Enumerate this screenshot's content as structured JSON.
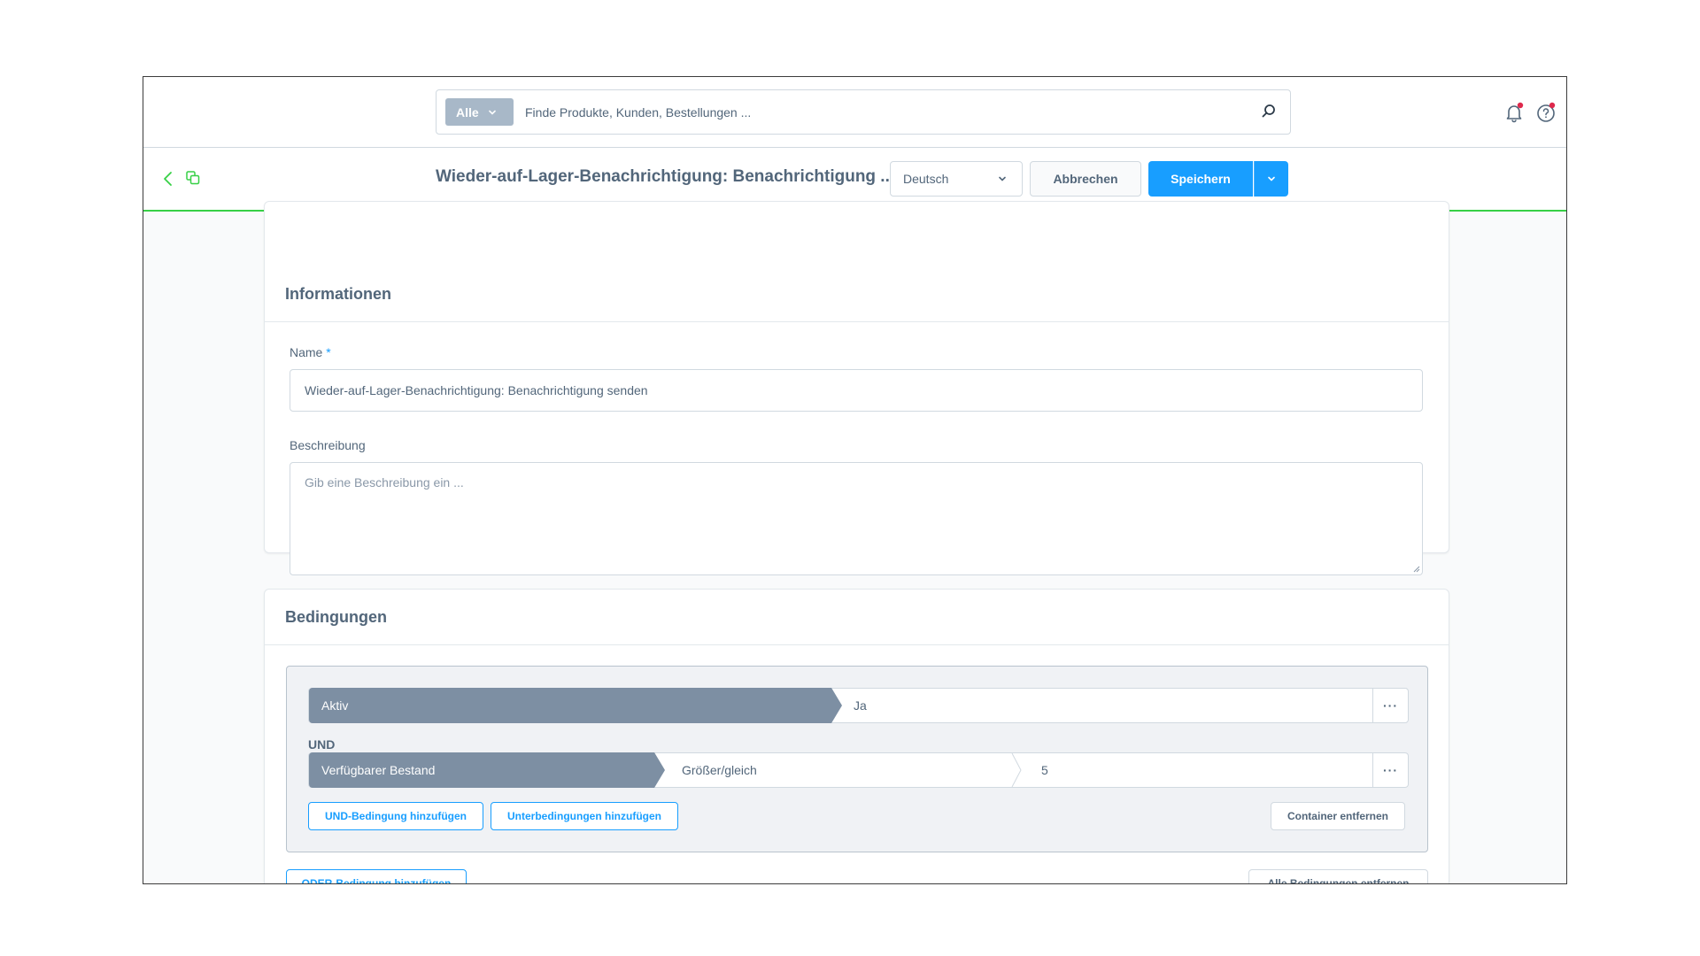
{
  "search": {
    "type_label": "Alle",
    "placeholder": "Finde Produkte, Kunden, Bestellungen ..."
  },
  "header": {
    "title": "Wieder-auf-Lager-Benachrichtigung: Benachrichtigung ...",
    "language": "Deutsch",
    "cancel_label": "Abbrechen",
    "save_label": "Speichern"
  },
  "info_card": {
    "title": "Informationen",
    "name_label": "Name",
    "name_required_mark": "*",
    "name_value": "Wieder-auf-Lager-Benachrichtigung: Benachrichtigung senden",
    "description_label": "Beschreibung",
    "description_placeholder": "Gib eine Beschreibung ein ..."
  },
  "conditions_card": {
    "title": "Bedingungen",
    "rows": [
      {
        "field": "Aktiv",
        "value": "Ja"
      },
      {
        "field": "Verfügbarer Bestand",
        "operator": "Größer/gleich",
        "value": "5"
      }
    ],
    "connector": "UND",
    "add_and_label": "UND-Bedingung hinzufügen",
    "add_sub_label": "Unterbedingungen hinzufügen",
    "remove_container_label": "Container entfernen",
    "add_or_label": "ODER-Bedingung hinzufügen",
    "remove_all_label": "Alle Bedingungen entfernen",
    "more_glyph": "···"
  },
  "colors": {
    "accent": "#189eff",
    "success_line": "#37d046",
    "condition_field": "#7d8fa3",
    "badge": "#de294c"
  }
}
